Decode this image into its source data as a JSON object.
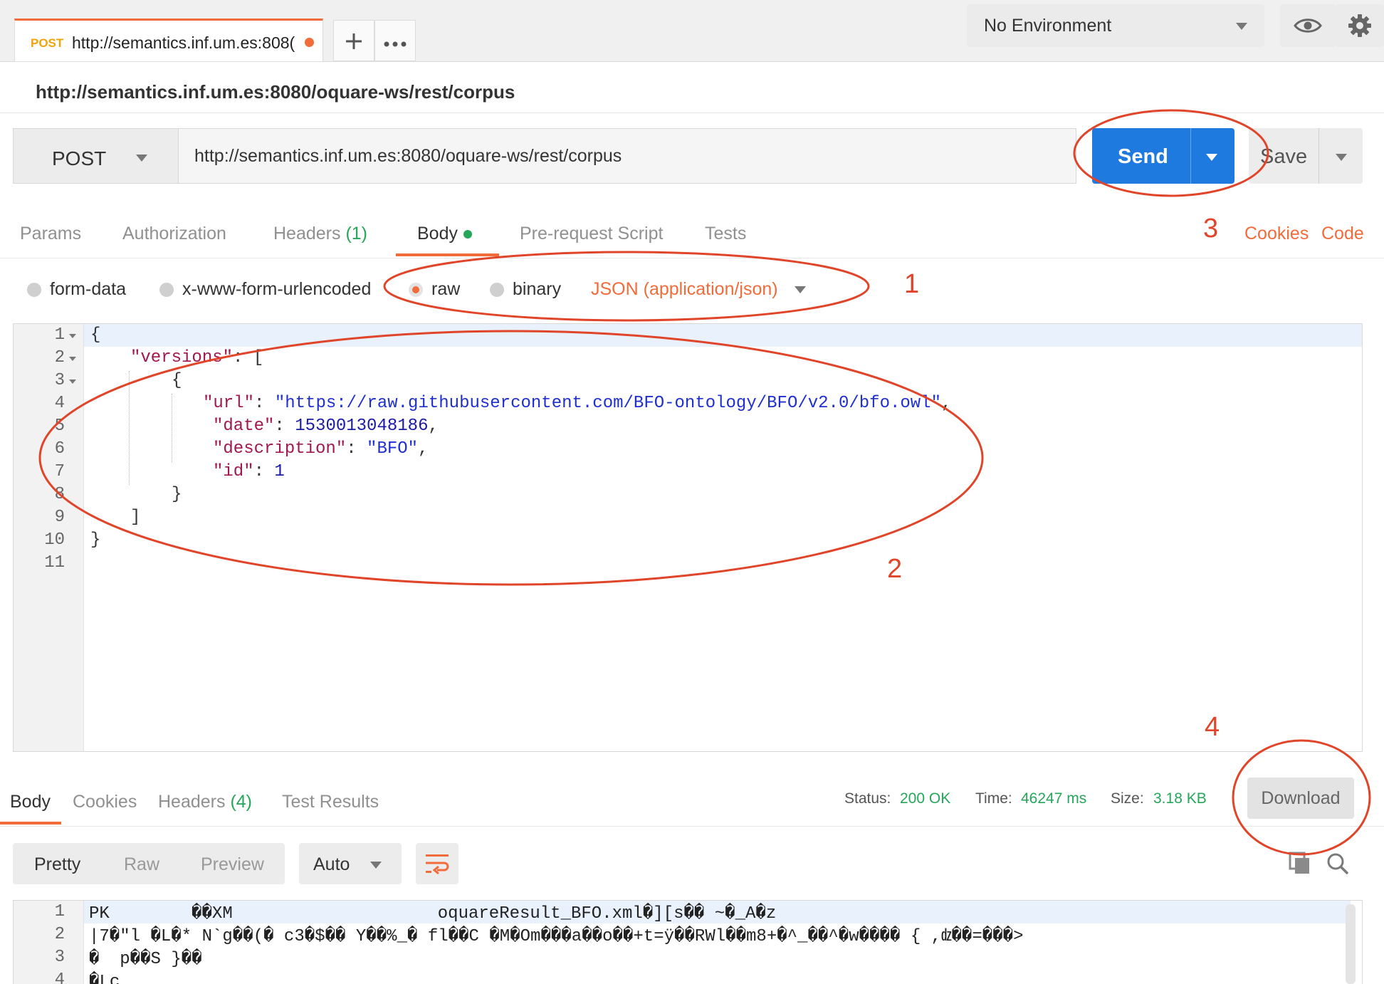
{
  "request_tab": {
    "method": "POST",
    "url": "http://semantics.inf.um.es:808(",
    "unsaved_color": "#f26b3a"
  },
  "tab_actions": {
    "new_icon": "plus-icon",
    "more_icon": "ellipsis-icon"
  },
  "environment": {
    "selected": "No Environment",
    "eye_icon": "eye-icon",
    "settings_icon": "gear-icon"
  },
  "request_title": "http://semantics.inf.um.es:8080/oquare-ws/rest/corpus",
  "request_bar": {
    "method": "POST",
    "url": "http://semantics.inf.um.es:8080/oquare-ws/rest/corpus",
    "send_label": "Send",
    "save_label": "Save"
  },
  "request_tabs": {
    "params": "Params",
    "authorization": "Authorization",
    "headers": "Headers",
    "headers_count": "(1)",
    "body": "Body",
    "pre_request": "Pre-request Script",
    "tests": "Tests",
    "cookies": "Cookies",
    "code": "Code"
  },
  "body_types": {
    "form_data": "form-data",
    "urlencoded": "x-www-form-urlencoded",
    "raw": "raw",
    "binary": "binary",
    "selected": "raw",
    "content_type": "JSON (application/json)"
  },
  "editor": {
    "line_numbers": [
      "1",
      "2",
      "3",
      "4",
      "5",
      "6",
      "7",
      "8",
      "9",
      "10",
      "11"
    ],
    "lines": {
      "l1": "{",
      "l2_key": "\"versions\"",
      "l2_rest": ": [",
      "l3": "{",
      "l4_key": "\"url\"",
      "l4_sep": ": ",
      "l4_val": "\"https://raw.githubusercontent.com/BFO-ontology/BFO/v2.0/bfo.owl\"",
      "l4_end": ",",
      "l5_key": "\"date\"",
      "l5_sep": ": ",
      "l5_val": "1530013048186",
      "l5_end": ",",
      "l6_key": "\"description\"",
      "l6_sep": ": ",
      "l6_val": "\"BFO\"",
      "l6_end": ",",
      "l7_key": "\"id\"",
      "l7_sep": ": ",
      "l7_val": "1",
      "l8": "}",
      "l9": "]",
      "l10": "}"
    }
  },
  "response": {
    "tabs": {
      "body": "Body",
      "cookies": "Cookies",
      "headers": "Headers",
      "headers_count": "(4)",
      "test_results": "Test Results"
    },
    "status_label": "Status:",
    "status_value": "200 OK",
    "time_label": "Time:",
    "time_value": "46247 ms",
    "size_label": "Size:",
    "size_value": "3.18 KB",
    "download_label": "Download",
    "view_modes": [
      "Pretty",
      "Raw",
      "Preview"
    ],
    "active_view": "Pretty",
    "format": "Auto",
    "wrap_icon": "wrap-lines-icon",
    "copy_icon": "copy-icon",
    "search_icon": "search-icon",
    "line_numbers": [
      "1",
      "2",
      "3",
      "4"
    ],
    "lines": [
      "PK        ��XM                    oquareResult_BFO.xml�][s�� ~�_A�z",
      "|7�\"l �L�* N`g��(� c3�$�� Y��%_� fl��C �M�Om���a��o��+t=ÿ��RWl��m8+�^_��^�w���� { ,ǳ��=���>",
      "�  p��S }��",
      "�Lc"
    ]
  },
  "annotations": [
    "1",
    "2",
    "3",
    "4"
  ],
  "colors": {
    "accent": "#f26b3a",
    "send": "#1f7ae0",
    "success": "#26a65b",
    "annotation": "#e0452a"
  }
}
